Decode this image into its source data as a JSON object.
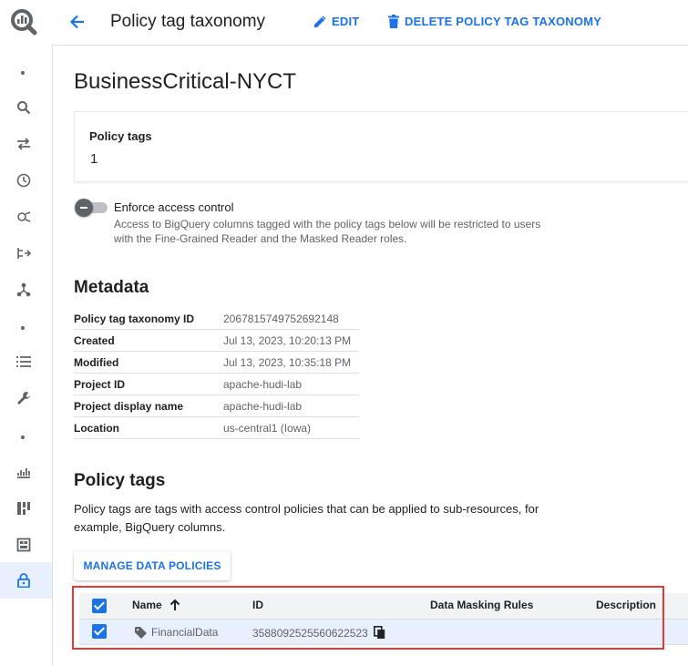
{
  "header": {
    "title": "Policy tag taxonomy",
    "edit_label": "EDIT",
    "delete_label": "DELETE POLICY TAG TAXONOMY"
  },
  "taxonomy": {
    "name": "BusinessCritical-NYCT",
    "policy_tags_label": "Policy tags",
    "policy_tags_count": "1"
  },
  "enforce": {
    "label": "Enforce access control",
    "description": "Access to BigQuery columns tagged with the policy tags below will be restricted to users with the Fine-Grained Reader and the Masked Reader roles.",
    "enabled": false
  },
  "metadata": {
    "heading": "Metadata",
    "rows": [
      {
        "key": "Policy tag taxonomy ID",
        "value": "2067815749752692148"
      },
      {
        "key": "Created",
        "value": "Jul 13, 2023, 10:20:13 PM"
      },
      {
        "key": "Modified",
        "value": "Jul 13, 2023, 10:35:18 PM"
      },
      {
        "key": "Project ID",
        "value": "apache-hudi-lab"
      },
      {
        "key": "Project display name",
        "value": "apache-hudi-lab"
      },
      {
        "key": "Location",
        "value": "us-central1 (Iowa)"
      }
    ]
  },
  "policy_tags": {
    "heading": "Policy tags",
    "description": "Policy tags are tags with access control policies that can be applied to sub-resources, for example, BigQuery columns.",
    "manage_label": "MANAGE DATA POLICIES",
    "columns": {
      "name": "Name",
      "id": "ID",
      "masking": "Data Masking Rules",
      "description": "Description"
    },
    "rows": [
      {
        "name": "FinancialData",
        "id": "3588092525560622523",
        "masking": "",
        "description": "",
        "selected": true
      }
    ]
  },
  "colors": {
    "accent": "#1a73e8",
    "highlight_border": "#e53935",
    "selected_row": "#e8f0fe"
  },
  "icons": [
    "bigquery-logo-icon",
    "search-icon",
    "transfer-icon",
    "history-icon",
    "analytics-hub-icon",
    "workflow-icon",
    "dataform-icon",
    "list-icon",
    "wrench-icon",
    "monitoring-icon",
    "dashboard-icon",
    "table-icon",
    "lock-icon",
    "back-arrow-icon",
    "pencil-icon",
    "trash-icon",
    "sort-arrow-up-icon",
    "tag-icon",
    "copy-icon"
  ]
}
